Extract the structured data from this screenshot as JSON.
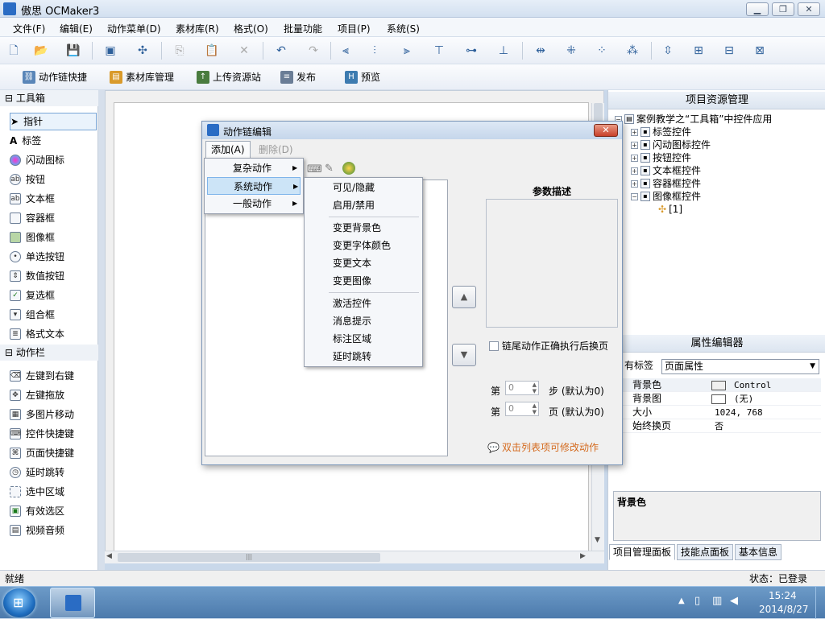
{
  "app": {
    "title": "傲思 OCMaker3",
    "window_controls": [
      "minimize-icon",
      "restore-icon",
      "close-icon"
    ]
  },
  "menubar": [
    "文件(F)",
    "编辑(E)",
    "动作菜单(D)",
    "素材库(R)",
    "格式(O)",
    "批量功能",
    "项目(P)",
    "系统(S)"
  ],
  "toolbar2": [
    "动作链快捷",
    "素材库管理",
    "上传资源站",
    "发布",
    "预览"
  ],
  "toolbox": {
    "header": "工具箱",
    "items": [
      "指针",
      "标签",
      "闪动图标",
      "按钮",
      "文本框",
      "容器框",
      "图像框",
      "单选按钮",
      "数值按钮",
      "复选框",
      "组合框",
      "格式文本"
    ],
    "action_header": "动作栏",
    "actions": [
      "左键到右键",
      "左键拖放",
      "多图片移动",
      "控件快捷键",
      "页面快捷键",
      "延时跳转",
      "选中区域",
      "有效选区",
      "视频音频"
    ]
  },
  "project": {
    "header": "项目资源管理",
    "root": "案例教学之“工具箱”中控件应用",
    "nodes": [
      "标签控件",
      "闪动图标控件",
      "按钮控件",
      "文本框控件",
      "容器框控件",
      "图像框控件"
    ],
    "leaf": "[1]"
  },
  "props": {
    "header": "属性编辑器",
    "tag_label": "有标签",
    "tag_value": "页面属性",
    "rows": [
      {
        "name": "背景色",
        "value": "Control"
      },
      {
        "name": "背景图",
        "value": "(无)"
      },
      {
        "name": "大小",
        "value": "1024, 768"
      },
      {
        "name": "始终换页",
        "value": "否"
      }
    ],
    "desc_title": "背景色"
  },
  "bottom_tabs": [
    "项目管理面板",
    "技能点面板",
    "基本信息"
  ],
  "status": {
    "left": "就绪",
    "right": "状态：已登录"
  },
  "clock": {
    "time": "15:24",
    "date": "2014/8/27"
  },
  "dialog": {
    "title": "动作链编辑",
    "menu_add": "添加(A)",
    "menu_delete": "删除(D)",
    "param_title": "参数描述",
    "chain_checkbox": "链尾动作正确执行后换页",
    "step_prefix": "第",
    "step_value": "0",
    "step_suffix": "步 (默认为0)",
    "page_prefix": "第",
    "page_value": "0",
    "page_suffix": "页 (默认为0)",
    "hint": "双击列表项可修改动作",
    "add_menu": [
      "复杂动作",
      "系统动作",
      "一般动作"
    ],
    "system_menu_groups": [
      [
        "可见/隐藏",
        "启用/禁用"
      ],
      [
        "变更背景色",
        "变更字体颜色",
        "变更文本",
        "变更图像"
      ],
      [
        "激活控件",
        "消息提示",
        "标注区域",
        "延时跳转"
      ]
    ]
  },
  "colors": {
    "accent": "#3399ff",
    "menu_hover": "#cce4f7",
    "hint": "#d46a1e"
  }
}
